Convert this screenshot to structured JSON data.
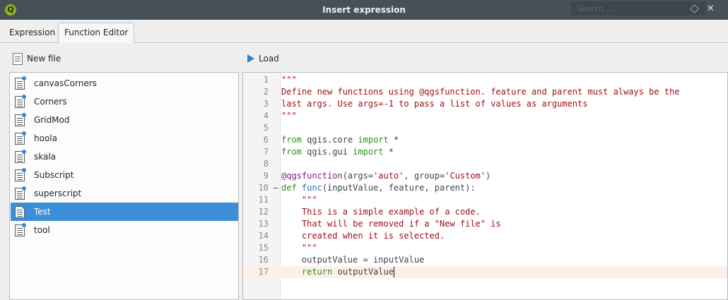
{
  "window": {
    "title": "Insert expression",
    "search_placeholder": "Search ...",
    "logo_letter": "Q"
  },
  "tabs": [
    {
      "label": "Expression",
      "active": false
    },
    {
      "label": "Function Editor",
      "active": true
    }
  ],
  "toolbar": {
    "new_file_label": "New file",
    "load_label": "Load"
  },
  "files": [
    {
      "label": "canvasCorners",
      "selected": false
    },
    {
      "label": "Corners",
      "selected": false
    },
    {
      "label": "GridMod",
      "selected": false
    },
    {
      "label": "hoola",
      "selected": false
    },
    {
      "label": "skala",
      "selected": false
    },
    {
      "label": "Subscript",
      "selected": false
    },
    {
      "label": "superscript",
      "selected": false
    },
    {
      "label": "Test",
      "selected": true
    },
    {
      "label": "tool",
      "selected": false
    }
  ],
  "code": {
    "current_line": 17,
    "lines": [
      {
        "n": "1",
        "tokens": [
          [
            "str",
            "\"\"\""
          ]
        ]
      },
      {
        "n": "2",
        "tokens": [
          [
            "str",
            "Define new functions using @qgsfunction. feature and parent must always be the"
          ]
        ]
      },
      {
        "n": "3",
        "tokens": [
          [
            "str",
            "last args. Use args=-1 to pass a list of values as arguments"
          ]
        ]
      },
      {
        "n": "4",
        "tokens": [
          [
            "str",
            "\"\"\""
          ]
        ]
      },
      {
        "n": "5",
        "tokens": []
      },
      {
        "n": "6",
        "tokens": [
          [
            "kw",
            "from"
          ],
          [
            "txt",
            " qgis.core "
          ],
          [
            "kw",
            "import"
          ],
          [
            "txt",
            " *"
          ]
        ]
      },
      {
        "n": "7",
        "tokens": [
          [
            "kw",
            "from"
          ],
          [
            "txt",
            " qgis.gui "
          ],
          [
            "kw",
            "import"
          ],
          [
            "txt",
            " *"
          ]
        ]
      },
      {
        "n": "8",
        "tokens": []
      },
      {
        "n": "9",
        "tokens": [
          [
            "dec",
            "@qgsfunction"
          ],
          [
            "txt",
            "(args="
          ],
          [
            "str2",
            "'auto'"
          ],
          [
            "txt",
            ", group="
          ],
          [
            "str2",
            "'Custom'"
          ],
          [
            "txt",
            ")"
          ]
        ]
      },
      {
        "n": "10",
        "tokens": [
          [
            "kw",
            "def"
          ],
          [
            "txt",
            " "
          ],
          [
            "fn",
            "func"
          ],
          [
            "txt",
            "(inputValue, feature, parent):"
          ]
        ],
        "fold": true
      },
      {
        "n": "11",
        "tokens": [
          [
            "txt",
            "    "
          ],
          [
            "str",
            "\"\"\""
          ]
        ]
      },
      {
        "n": "12",
        "tokens": [
          [
            "txt",
            "    "
          ],
          [
            "str",
            "This is a simple example of a code."
          ]
        ]
      },
      {
        "n": "13",
        "tokens": [
          [
            "txt",
            "    "
          ],
          [
            "str",
            "That will be removed if a \"New file\" is"
          ]
        ]
      },
      {
        "n": "14",
        "tokens": [
          [
            "txt",
            "    "
          ],
          [
            "str",
            "created when it is selected."
          ]
        ]
      },
      {
        "n": "15",
        "tokens": [
          [
            "txt",
            "    "
          ],
          [
            "str",
            "\"\"\""
          ]
        ]
      },
      {
        "n": "16",
        "tokens": [
          [
            "txt",
            "    outputValue = inputValue"
          ]
        ]
      },
      {
        "n": "17",
        "tokens": [
          [
            "txt",
            "    "
          ],
          [
            "kw",
            "return"
          ],
          [
            "txt",
            " outputValue"
          ]
        ]
      }
    ]
  },
  "colors": {
    "kw": "#2c8e1e",
    "str": "#a0101a",
    "str2": "#a0101a",
    "dec": "#7a1d7a",
    "fn": "#2d6cae",
    "txt": "#3e4345",
    "selection": "#3d8ed9"
  }
}
